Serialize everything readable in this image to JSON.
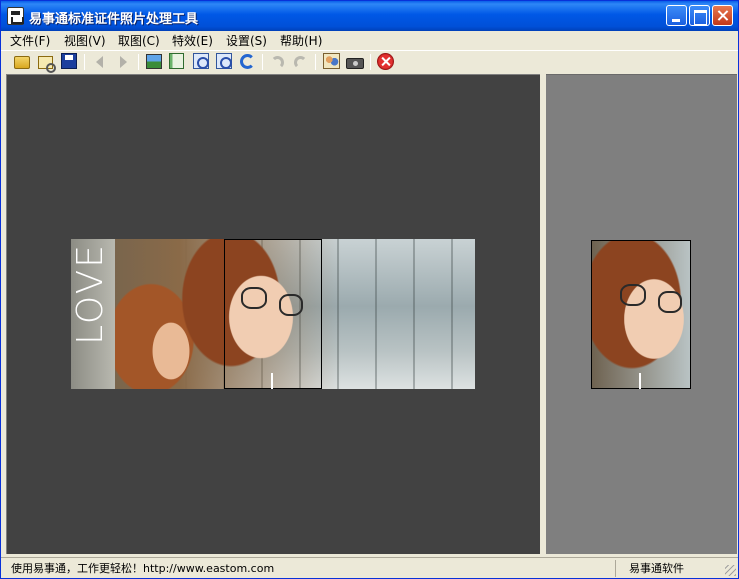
{
  "window": {
    "title": "易事通标准证件照片处理工具"
  },
  "menu": {
    "items": [
      {
        "label": "文件(F)"
      },
      {
        "label": "视图(V)"
      },
      {
        "label": "取图(C)"
      },
      {
        "label": "特效(E)"
      },
      {
        "label": "设置(S)"
      },
      {
        "label": "帮助(H)"
      }
    ]
  },
  "toolbar": {
    "buttons": [
      {
        "icon": "open-folder-icon",
        "enabled": true
      },
      {
        "icon": "print-preview-icon",
        "enabled": true
      },
      {
        "icon": "save-disk-icon",
        "enabled": true
      },
      {
        "icon": "back-arrow-icon",
        "enabled": false
      },
      {
        "icon": "forward-arrow-icon",
        "enabled": false
      },
      {
        "icon": "picture-icon",
        "enabled": true
      },
      {
        "icon": "document-icon",
        "enabled": true
      },
      {
        "icon": "zoom-in-icon",
        "enabled": true
      },
      {
        "icon": "zoom-out-icon",
        "enabled": true
      },
      {
        "icon": "rotate-icon",
        "enabled": true
      },
      {
        "icon": "undo-icon",
        "enabled": false
      },
      {
        "icon": "redo-icon",
        "enabled": false
      },
      {
        "icon": "people-photo-icon",
        "enabled": true
      },
      {
        "icon": "camera-icon",
        "enabled": true
      },
      {
        "icon": "exit-icon",
        "enabled": true
      }
    ]
  },
  "workspace": {
    "photo_text": "LOVE",
    "colors": {
      "main_bg": "#424242",
      "preview_bg": "#7F7F7F",
      "titlebar": "#0058E6"
    }
  },
  "statusbar": {
    "left_text": "使用易事通，工作更轻松！http://www.eastom.com",
    "right_text": "易事通软件"
  }
}
